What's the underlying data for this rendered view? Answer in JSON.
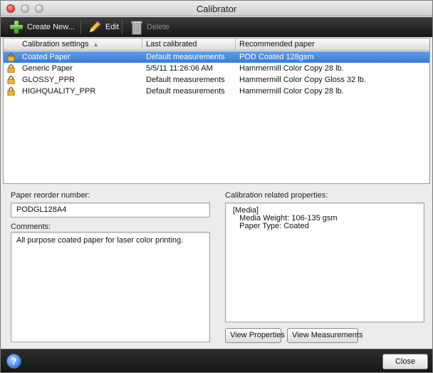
{
  "window": {
    "title": "Calibrator"
  },
  "toolbar": {
    "create_label": "Create New...",
    "edit_label": "Edit",
    "delete_label": "Delete"
  },
  "table": {
    "columns": [
      "Calibration settings",
      "Last calibrated",
      "Recommended paper"
    ],
    "sort_indicator": "▲",
    "rows": [
      {
        "setting": "Coated Paper",
        "last_calibrated": "Default measurements",
        "paper": "POD Coated 128gsm",
        "selected": true
      },
      {
        "setting": "Generic Paper",
        "last_calibrated": "5/5/11 11:26:06 AM",
        "paper": "Hammermill Color Copy 28 lb.",
        "selected": false
      },
      {
        "setting": "GLOSSY_PPR",
        "last_calibrated": "Default measurements",
        "paper": "Hammermill Color Copy Gloss 32 lb.",
        "selected": false
      },
      {
        "setting": "HIGHQUALITY_PPR",
        "last_calibrated": "Default measurements",
        "paper": "Hammermill Color Copy 28 lb.",
        "selected": false
      }
    ],
    "row_icon": "lock-icon"
  },
  "details": {
    "reorder_label": "Paper reorder number:",
    "reorder_value": "PODGL128A4",
    "comments_label": "Comments:",
    "comments_value": "All purpose coated paper for laser color printing.",
    "properties_label": "Calibration related properties:",
    "properties_value": "[Media]\n   Media Weight: 106-135 gsm\n   Paper Type: Coated",
    "view_properties_label": "View Properties",
    "view_measurements_label": "View Measurements"
  },
  "footer": {
    "help_label": "?",
    "close_label": "Close"
  },
  "colors": {
    "selection": "#3a7cd5",
    "toolbar": "#1f1f1f",
    "lock": "#e8a21c"
  }
}
